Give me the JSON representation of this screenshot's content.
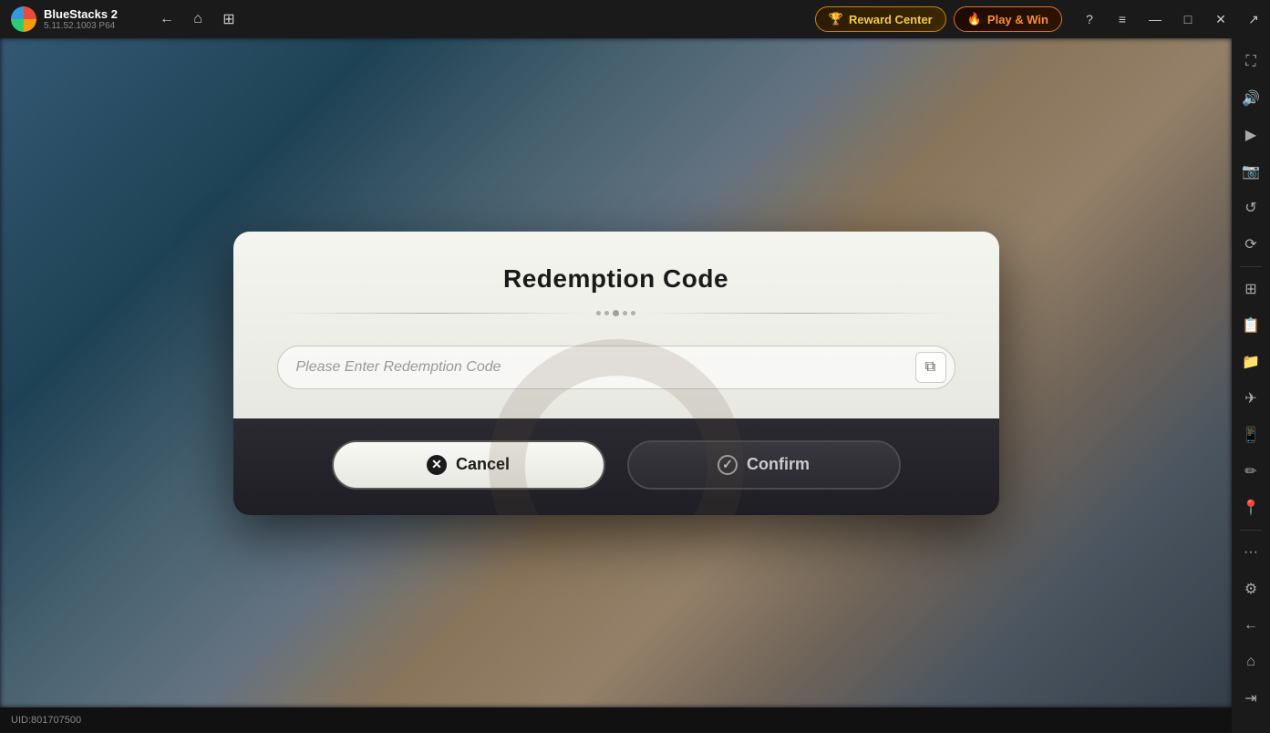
{
  "app": {
    "name": "BlueStacks 2",
    "version": "5.11.52.1003  P64"
  },
  "topbar": {
    "back_label": "←",
    "home_label": "⌂",
    "layout_label": "⊞",
    "reward_label": "Reward Center",
    "reward_icon": "🏆",
    "play_label": "Play & Win",
    "play_icon": "🔥",
    "help_icon": "?",
    "menu_icon": "≡",
    "minimize_icon": "—",
    "maximize_icon": "□",
    "close_icon": "✕",
    "expand_icon": "↗"
  },
  "sidebar": {
    "items": [
      {
        "icon": "⛶",
        "name": "fullscreen-icon"
      },
      {
        "icon": "🔊",
        "name": "volume-icon"
      },
      {
        "icon": "▶",
        "name": "record-icon"
      },
      {
        "icon": "📷",
        "name": "screenshot-icon"
      },
      {
        "icon": "↺",
        "name": "rotate-icon"
      },
      {
        "icon": "⟳",
        "name": "refresh-icon"
      },
      {
        "icon": "⊞",
        "name": "multiinstance-icon"
      },
      {
        "icon": "📋",
        "name": "macro-icon"
      },
      {
        "icon": "📁",
        "name": "files-icon"
      },
      {
        "icon": "✈",
        "name": "airplane-icon"
      },
      {
        "icon": "📱",
        "name": "device-icon"
      },
      {
        "icon": "✏",
        "name": "draw-icon"
      },
      {
        "icon": "📍",
        "name": "location-icon"
      },
      {
        "icon": "•••",
        "name": "more-icon"
      },
      {
        "icon": "⚙",
        "name": "settings-icon"
      },
      {
        "icon": "←",
        "name": "back-icon"
      },
      {
        "icon": "⌂",
        "name": "home-side-icon"
      },
      {
        "icon": "⇥",
        "name": "keyboard-icon"
      }
    ]
  },
  "dialog": {
    "title": "Redemption Code",
    "input_placeholder": "Please Enter Redemption Code",
    "cancel_label": "Cancel",
    "confirm_label": "Confirm"
  },
  "footer": {
    "uid_label": "UID:801707500"
  }
}
